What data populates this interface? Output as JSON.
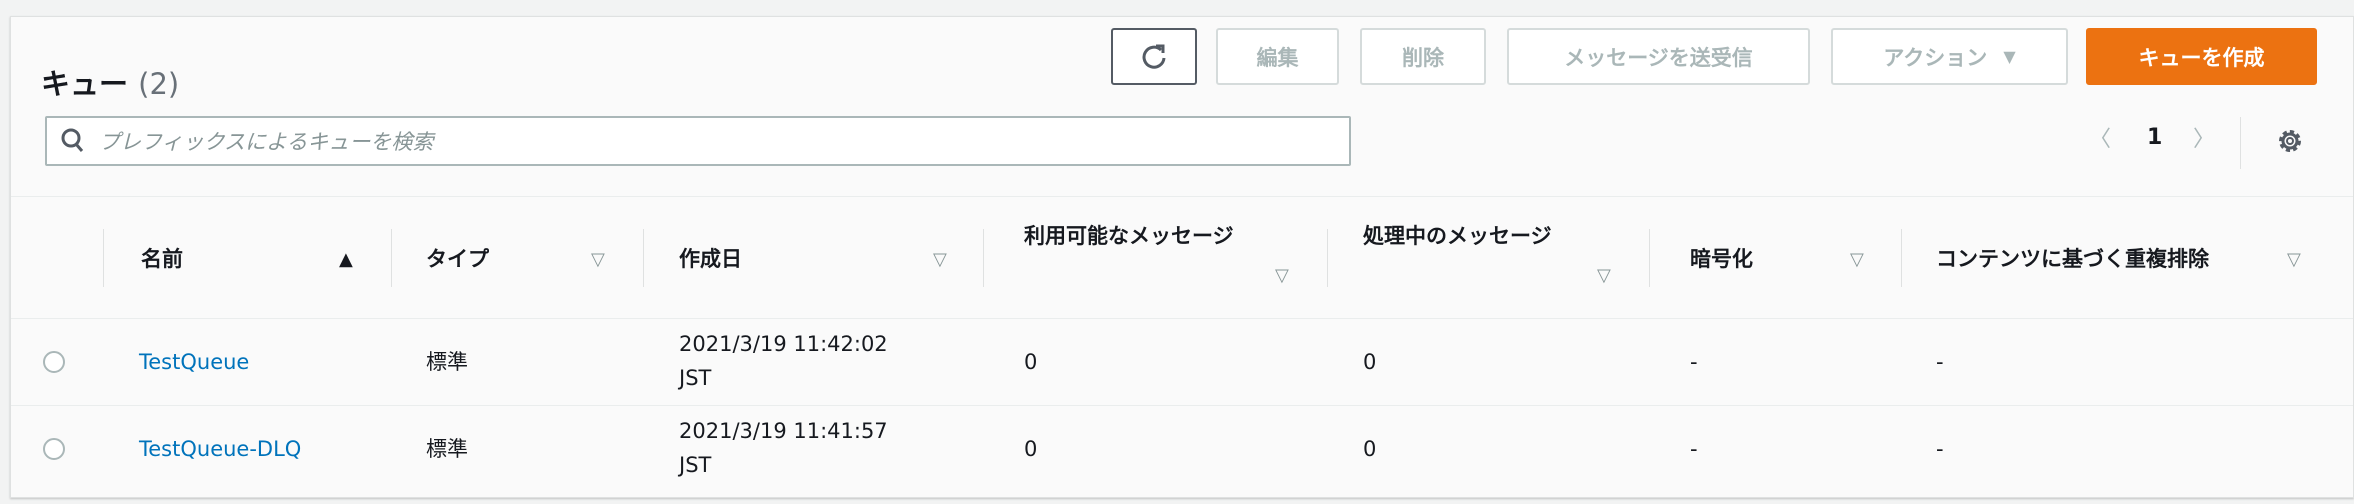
{
  "header": {
    "title": "キュー",
    "count": "(2)"
  },
  "toolbar": {
    "edit": "編集",
    "delete": "削除",
    "send": "メッセージを送受信",
    "actions": "アクション",
    "create": "キューを作成"
  },
  "search": {
    "placeholder": "プレフィックスによるキューを検索"
  },
  "pagination": {
    "page": "1"
  },
  "columns": [
    "名前",
    "タイプ",
    "作成日",
    "利用可能なメッセージ",
    "処理中のメッセージ",
    "暗号化",
    "コンテンツに基づく重複排除"
  ],
  "rows": [
    {
      "name": "TestQueue",
      "type": "標準",
      "created": "2021/3/19 11:42:02",
      "tz": "JST",
      "available": "0",
      "inflight": "0",
      "encryption": "-",
      "dedup": "-"
    },
    {
      "name": "TestQueue-DLQ",
      "type": "標準",
      "created": "2021/3/19 11:41:57",
      "tz": "JST",
      "available": "0",
      "inflight": "0",
      "encryption": "-",
      "dedup": "-"
    }
  ],
  "colors": {
    "primary": "#ec7211",
    "link": "#0073bb"
  }
}
